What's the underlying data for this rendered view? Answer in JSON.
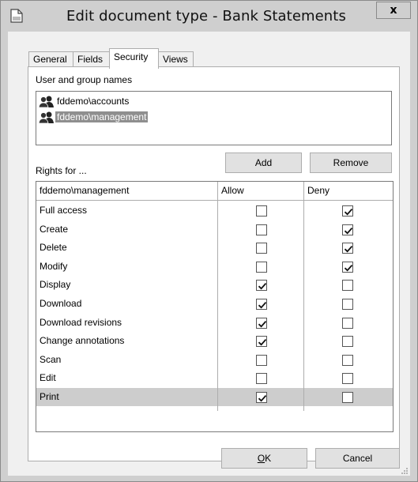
{
  "window": {
    "title": "Edit document type - Bank Statements",
    "close_label": "x"
  },
  "tabs": [
    {
      "label": "General",
      "active": false
    },
    {
      "label": "Fields",
      "active": false
    },
    {
      "label": "Security",
      "active": true
    },
    {
      "label": "Views",
      "active": false
    }
  ],
  "security": {
    "users_label": "User and group names",
    "users": [
      {
        "name": "fddemo\\accounts",
        "selected": false
      },
      {
        "name": "fddemo\\management",
        "selected": true
      }
    ],
    "add_label": "Add",
    "remove_label": "Remove",
    "rights_label": "Rights for ...",
    "grid": {
      "header_name": "fddemo\\management",
      "header_allow": "Allow",
      "header_deny": "Deny",
      "rows": [
        {
          "name": "Full access",
          "allow": false,
          "deny": true
        },
        {
          "name": "Create",
          "allow": false,
          "deny": true
        },
        {
          "name": "Delete",
          "allow": false,
          "deny": true
        },
        {
          "name": "Modify",
          "allow": false,
          "deny": true
        },
        {
          "name": "Display",
          "allow": true,
          "deny": false
        },
        {
          "name": "Download",
          "allow": true,
          "deny": false
        },
        {
          "name": "Download revisions",
          "allow": true,
          "deny": false
        },
        {
          "name": "Change annotations",
          "allow": true,
          "deny": false
        },
        {
          "name": "Scan",
          "allow": false,
          "deny": false
        },
        {
          "name": "Edit",
          "allow": false,
          "deny": false
        },
        {
          "name": "Print",
          "allow": true,
          "deny": false,
          "selected": true
        }
      ]
    }
  },
  "footer": {
    "ok_label": "OK",
    "ok_mnemonic": "O",
    "cancel_label": "Cancel"
  },
  "icons": {
    "window_icon": "document-icon",
    "user_icon": "user-group-icon",
    "check_icon": "checkmark-icon",
    "grip_icon": "resize-grip-icon"
  }
}
